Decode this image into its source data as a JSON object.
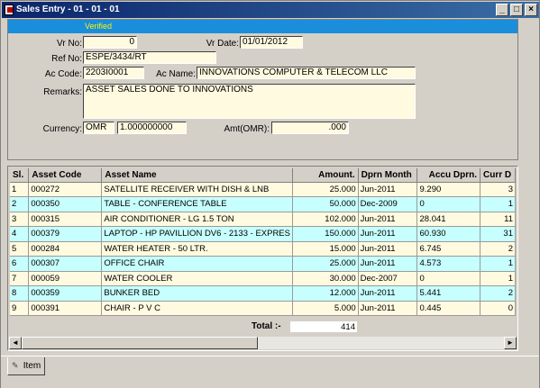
{
  "window": {
    "title": "Sales Entry - 01 - 01 - 01",
    "buttons": {
      "minimize": "_",
      "maximize": "□",
      "close": "×"
    }
  },
  "status": {
    "verified": "Verified"
  },
  "form": {
    "vr_no_label": "Vr No:",
    "vr_no": "0",
    "vr_date_label": "Vr Date:",
    "vr_date": "01/01/2012",
    "ref_no_label": "Ref No:",
    "ref_no": "ESPE/3434/RT",
    "ac_code_label": "Ac Code:",
    "ac_code": "2203I0001",
    "ac_name_label": "Ac Name:",
    "ac_name": "INNOVATIONS COMPUTER & TELECOM LLC",
    "remarks_label": "Remarks:",
    "remarks": "ASSET SALES DONE TO INNOVATIONS",
    "currency_label": "Currency:",
    "currency": "OMR",
    "rate": "1.000000000",
    "amt_label": "Amt(OMR):",
    "amt": ".000"
  },
  "grid": {
    "columns": [
      "Sl.",
      "Asset Code",
      "Asset Name",
      "Amount.",
      "Dprn Month",
      "Accu Dprn.",
      "Curr D"
    ],
    "rows": [
      [
        "1",
        "000272",
        "SATELLITE RECEIVER WITH DISH & LNB",
        "25.000",
        "Jun-2011",
        "9.290",
        "3"
      ],
      [
        "2",
        "000350",
        "TABLE - CONFERENCE TABLE",
        "50.000",
        "Dec-2009",
        "0",
        "1"
      ],
      [
        "3",
        "000315",
        "AIR CONDITIONER - LG 1.5 TON",
        "102.000",
        "Jun-2011",
        "28.041",
        "11"
      ],
      [
        "4",
        "000379",
        "LAPTOP - HP PAVILLION DV6 - 2133 - EXPRES",
        "150.000",
        "Jun-2011",
        "60.930",
        "31"
      ],
      [
        "5",
        "000284",
        "WATER HEATER - 50 LTR.",
        "15.000",
        "Jun-2011",
        "6.745",
        "2"
      ],
      [
        "6",
        "000307",
        "OFFICE CHAIR",
        "25.000",
        "Jun-2011",
        "4.573",
        "1"
      ],
      [
        "7",
        "000059",
        "WATER COOLER",
        "30.000",
        "Dec-2007",
        "0",
        "1"
      ],
      [
        "8",
        "000359",
        "BUNKER BED",
        "12.000",
        "Jun-2011",
        "5.441",
        "2"
      ],
      [
        "9",
        "000391",
        "CHAIR - P V C",
        "5.000",
        "Jun-2011",
        "0.445",
        "0"
      ]
    ]
  },
  "total": {
    "label": "Total :-",
    "value": "414"
  },
  "scroll": {
    "left": "◄",
    "right": "►"
  },
  "tabs": [
    {
      "label": "Item"
    }
  ]
}
